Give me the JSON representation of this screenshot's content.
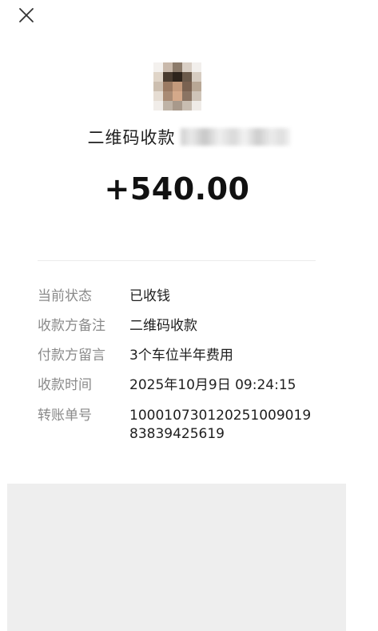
{
  "header": {
    "close_icon": "close-icon"
  },
  "payee": {
    "label": "二维码收款"
  },
  "amount": "+540.00",
  "details": {
    "status": {
      "label": "当前状态",
      "value": "已收钱"
    },
    "payee_note": {
      "label": "收款方备注",
      "value": "二维码收款"
    },
    "payer_message": {
      "label": "付款方留言",
      "value": "3个车位半年费用"
    },
    "time": {
      "label": "收款时间",
      "value": "2025年10月9日 09:24:15"
    },
    "transfer_id": {
      "label": "转账单号",
      "value": "10001073012025100901983839425619"
    }
  },
  "colors": {
    "background": "#ffffff",
    "label_gray": "#8a8a8a",
    "text": "#1e1e1e",
    "divider": "#ebebeb",
    "bottom_panel": "#eeeeee"
  }
}
